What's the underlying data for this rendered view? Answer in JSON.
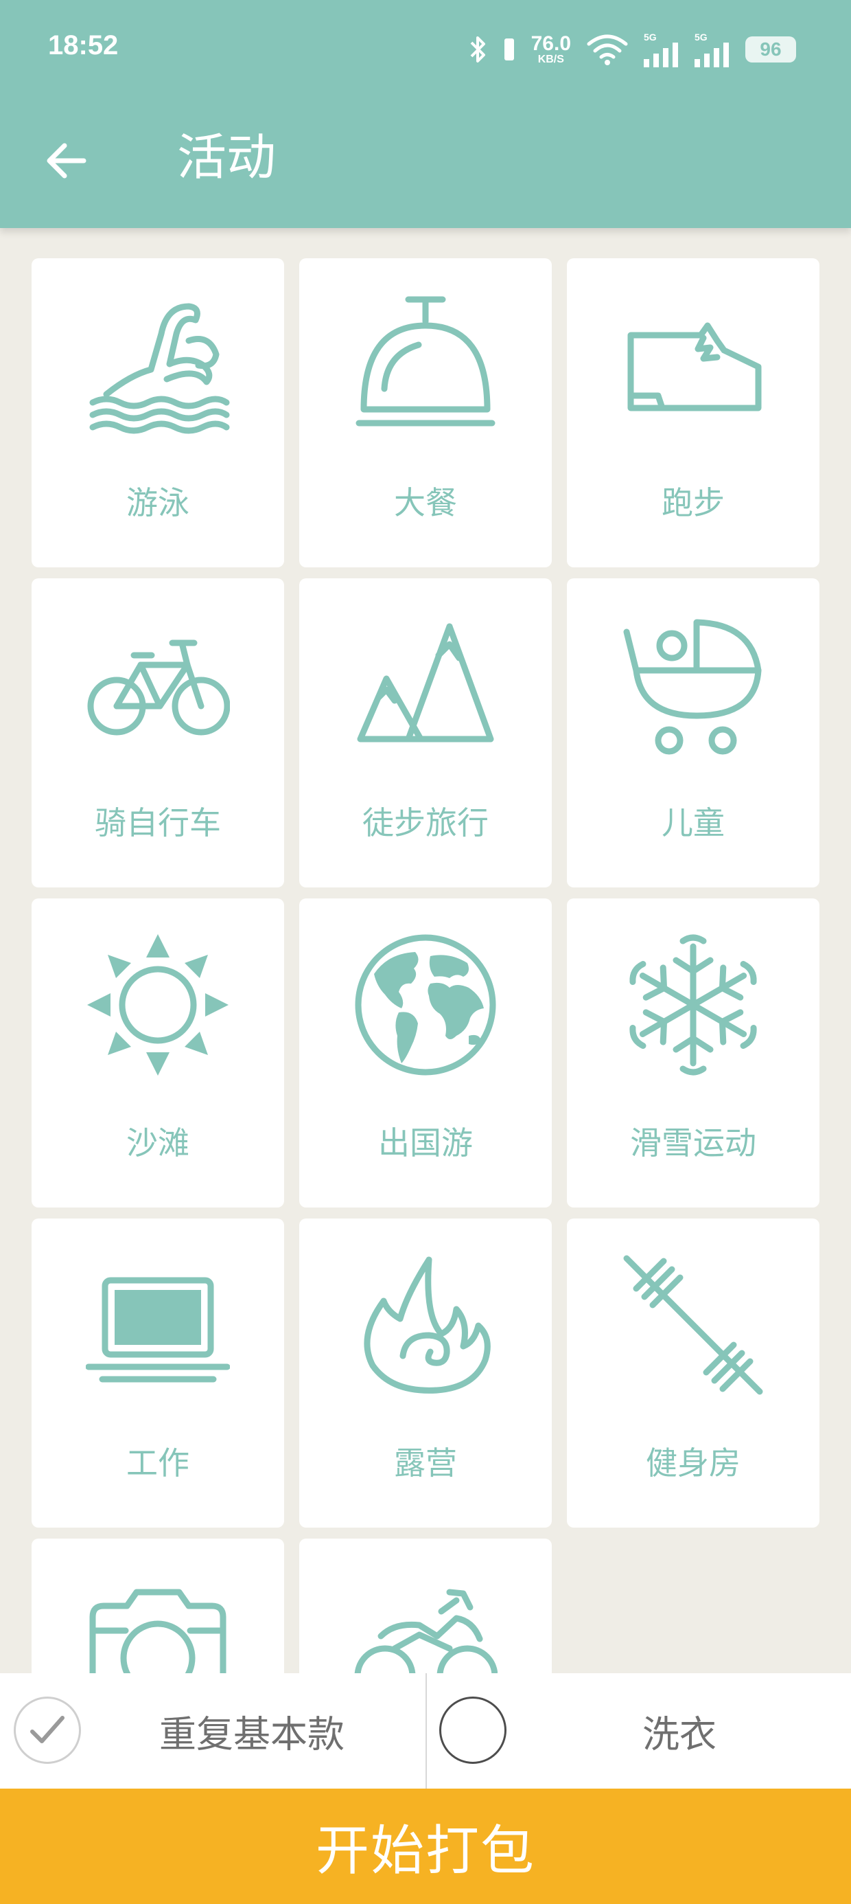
{
  "status_bar": {
    "time": "18:52",
    "net_speed_value": "76.0",
    "net_speed_unit": "KB/S",
    "signal_label_1": "5G",
    "signal_label_2": "5G",
    "battery": "96"
  },
  "app_bar": {
    "title": "活动"
  },
  "activities": [
    {
      "label": "游泳",
      "icon": "swimming-icon"
    },
    {
      "label": "大餐",
      "icon": "dinner-cloche-icon"
    },
    {
      "label": "跑步",
      "icon": "running-shoe-icon"
    },
    {
      "label": "骑自行车",
      "icon": "bicycle-icon"
    },
    {
      "label": "徒步旅行",
      "icon": "mountains-icon"
    },
    {
      "label": "儿童",
      "icon": "stroller-icon"
    },
    {
      "label": "沙滩",
      "icon": "sun-icon"
    },
    {
      "label": "出国游",
      "icon": "globe-icon"
    },
    {
      "label": "滑雪运动",
      "icon": "snowflake-icon"
    },
    {
      "label": "工作",
      "icon": "laptop-icon"
    },
    {
      "label": "露营",
      "icon": "campfire-icon"
    },
    {
      "label": "健身房",
      "icon": "dumbbell-icon"
    },
    {
      "label": "",
      "icon": "camera-icon"
    },
    {
      "label": "",
      "icon": "motorcycle-icon"
    }
  ],
  "options": {
    "repeat_basics": "重复基本款",
    "laundry": "洗衣"
  },
  "start_button": "开始打包",
  "colors": {
    "primary": "#86c5b9",
    "accent": "#f6b223",
    "background": "#efede6"
  }
}
